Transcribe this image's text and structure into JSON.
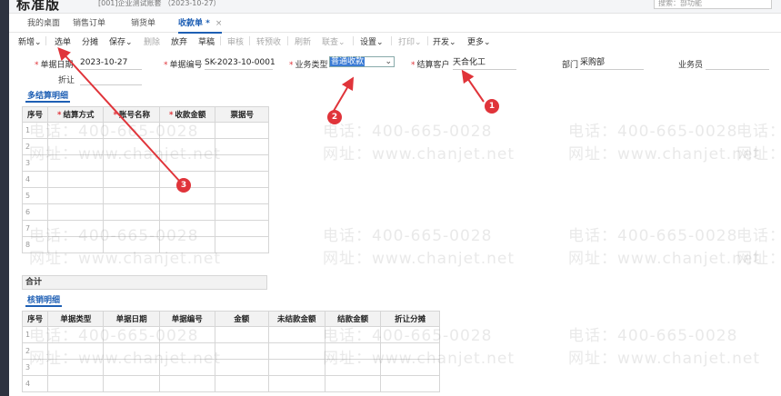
{
  "header": {
    "logo": "标准版",
    "account": "[001]企业测试账套 （2023-10-27）",
    "search_placeholder": "搜索：部功能"
  },
  "tabs": [
    {
      "label": "我的桌面"
    },
    {
      "label": "销售订单"
    },
    {
      "label": "销货单"
    },
    {
      "label": "收款单 *",
      "close": "×"
    }
  ],
  "toolbar": {
    "new": "新增",
    "select": "选单",
    "split": "分摊",
    "save": "保存",
    "delete": "删除",
    "discard": "放弃",
    "draft": "草稿",
    "audit": "审核",
    "convert": "转预收",
    "refresh": "刷新",
    "query": "联查",
    "settings": "设置",
    "print": "打印",
    "develop": "开发",
    "more": "更多"
  },
  "form": {
    "date_label": "单据日期",
    "date_value": "2023-10-27",
    "docno_label": "单据编号",
    "docno_value": "SK-2023-10-0001",
    "biztype_label": "业务类型",
    "biztype_value": "普通收款",
    "customer_label": "结算客户",
    "customer_value": "天合化工",
    "dept_label": "部门",
    "dept_value": "采购部",
    "salesman_label": "业务员",
    "discount_label": "折让"
  },
  "settlement": {
    "title": "多结算明细",
    "headers": [
      "序号",
      "结算方式",
      "账号名称",
      "收款金额",
      "票据号"
    ],
    "required": [
      false,
      true,
      true,
      true,
      false
    ],
    "rows": [
      "1",
      "2",
      "3",
      "4",
      "5",
      "6",
      "7",
      "8"
    ]
  },
  "summary": {
    "label": "合计"
  },
  "writeoff": {
    "title": "核销明细",
    "headers": [
      "序号",
      "单据类型",
      "单据日期",
      "单据编号",
      "金额",
      "未结款金额",
      "结款金额",
      "折让分摊"
    ],
    "rows": [
      "1",
      "2",
      "3",
      "4"
    ]
  },
  "watermark": {
    "phone": "电话：400-665-0028",
    "site": "网址：www.chanjet.net"
  },
  "annotations": [
    "1",
    "2",
    "3"
  ],
  "colors": {
    "accent": "#1e5fb4",
    "required": "#e0343a",
    "annotation": "#e0343a"
  }
}
